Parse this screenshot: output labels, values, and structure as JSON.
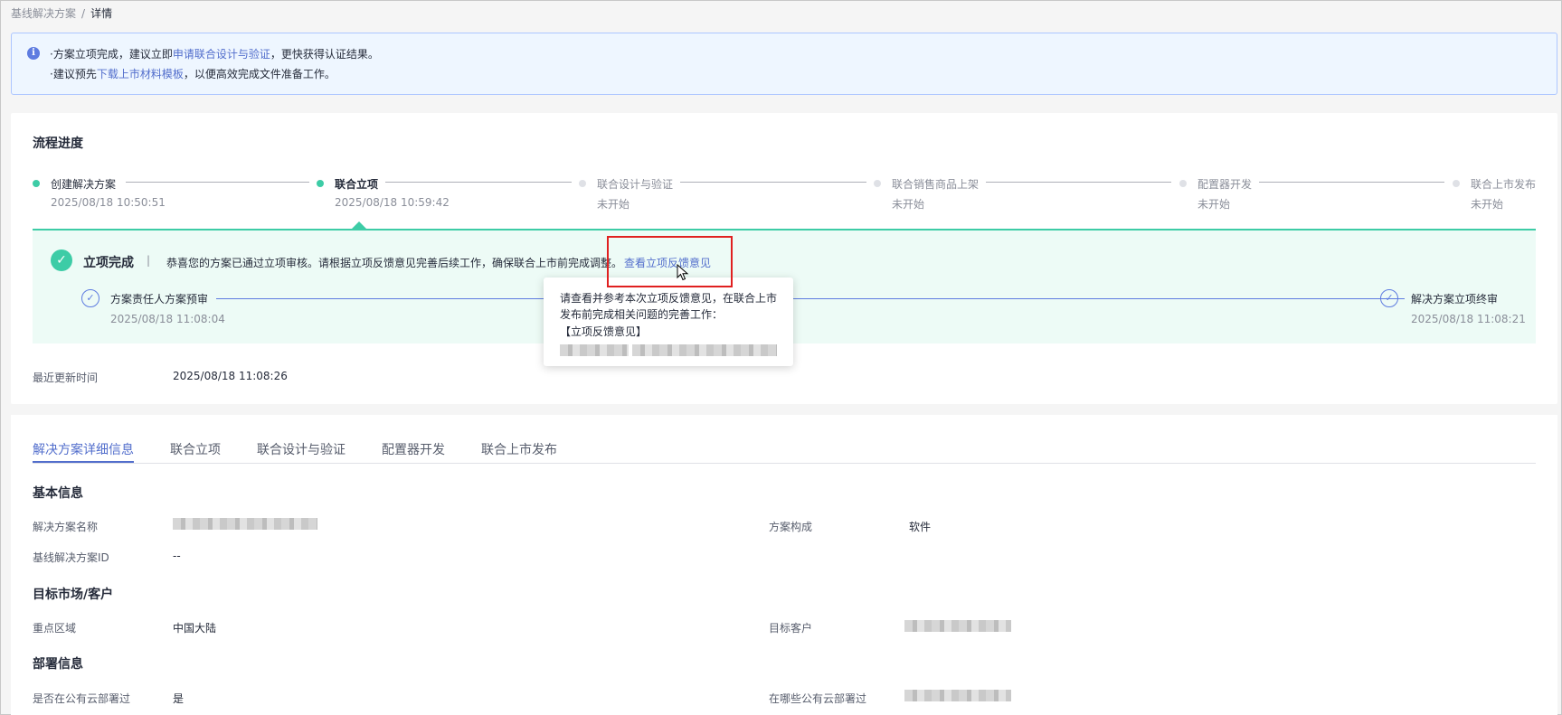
{
  "breadcrumb": {
    "parent": "基线解决方案",
    "separator": "/",
    "current": "详情"
  },
  "notice": {
    "line1_prefix": "·方案立项完成，建议立即",
    "line1_link": "申请联合设计与验证",
    "line1_suffix": "，更快获得认证结果。",
    "line2_prefix": "·建议预先",
    "line2_link": "下载上市材料模板",
    "line2_suffix": "，以便高效完成文件准备工作。"
  },
  "progress": {
    "title": "流程进度",
    "steps": [
      {
        "name": "创建解决方案",
        "time": "2025/08/18 10:50:51",
        "state": "done"
      },
      {
        "name": "联合立项",
        "time": "2025/08/18 10:59:42",
        "state": "active"
      },
      {
        "name": "联合设计与验证",
        "time": "未开始",
        "state": "todo"
      },
      {
        "name": "联合销售商品上架",
        "time": "未开始",
        "state": "todo"
      },
      {
        "name": "配置器开发",
        "time": "未开始",
        "state": "todo"
      },
      {
        "name": "联合上市发布",
        "time": "未开始",
        "state": "todo"
      }
    ],
    "panel": {
      "status": "立项完成",
      "divider": "|",
      "message": "恭喜您的方案已通过立项审核。请根据立项反馈意见完善后续工作，确保联合上市前完成调整。",
      "feedback_link": "查看立项反馈意见",
      "substeps": [
        {
          "name": "方案责任人方案预审",
          "time": "2025/08/18 11:08:04"
        },
        {
          "name": "解决方案立项终审",
          "time": "2025/08/18 11:08:21"
        }
      ]
    },
    "tooltip": {
      "line1": "请查看并参考本次立项反馈意见，在联合上市",
      "line2": "发布前完成相关问题的完善工作：",
      "line3": "【立项反馈意见】"
    },
    "last_update_label": "最近更新时间",
    "last_update_value": "2025/08/18 11:08:26"
  },
  "tabs": [
    "解决方案详细信息",
    "联合立项",
    "联合设计与验证",
    "配置器开发",
    "联合上市发布"
  ],
  "details": {
    "basic_title": "基本信息",
    "solution_name_label": "解决方案名称",
    "composition_label": "方案构成",
    "composition_value": "软件",
    "baseline_id_label": "基线解决方案ID",
    "baseline_id_value": "--",
    "market_title": "目标市场/客户",
    "region_label": "重点区域",
    "region_value": "中国大陆",
    "customer_label": "目标客户",
    "deploy_title": "部署信息",
    "public_cloud_label": "是否在公有云部署过",
    "public_cloud_value": "是",
    "which_cloud_label": "在哪些公有云部署过"
  },
  "colors": {
    "accent": "#526ecc",
    "success": "#3dcca6",
    "highlight": "#e02020"
  }
}
